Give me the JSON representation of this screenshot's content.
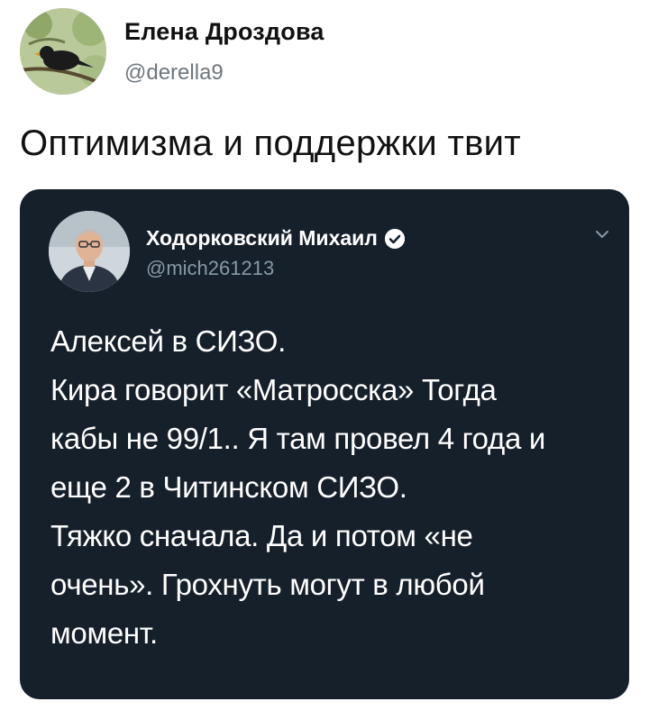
{
  "outer_tweet": {
    "author_name": "Елена Дроздова",
    "author_handle": "@derella9",
    "text": "Оптимизма и поддержки твит",
    "avatar_icon": "bird-on-branch-avatar"
  },
  "quoted_tweet": {
    "author_name": "Ходорковский Михаил",
    "author_handle": "@mich261213",
    "verified_icon": "verified-badge-icon",
    "menu_icon": "chevron-down-icon",
    "lines": [
      "Алексей в СИЗО.",
      "Кира говорит «Матросска» Тогда",
      "кабы не 99/1.. Я там провел 4 года и",
      "еще 2 в Читинском СИЗО.",
      "Тяжко сначала. Да и потом «не",
      "очень». Грохнуть могут в любой",
      "момент."
    ]
  },
  "colors": {
    "card_background": "#15202b",
    "secondary_text_dark": "#8899a6",
    "secondary_text_light": "#6e767d"
  }
}
